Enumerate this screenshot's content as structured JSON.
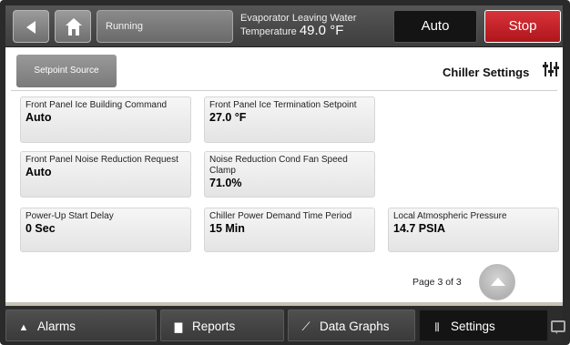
{
  "header": {
    "status_label": "Running",
    "evap_label_line1": "Evaporator Leaving Water",
    "evap_label_line2": "Temperature",
    "evap_value": "49.0 °F",
    "auto_label": "Auto",
    "stop_label": "Stop"
  },
  "panel": {
    "setpoint_source_label": "Setpoint Source",
    "title": "Chiller Settings",
    "tiles": [
      {
        "label": "Front Panel Ice Building Command",
        "value": "Auto"
      },
      {
        "label": "Front Panel Ice Termination Setpoint",
        "value": "27.0 °F"
      },
      {
        "label": "Front Panel Noise Reduction Request",
        "value": "Auto"
      },
      {
        "label": "Noise Reduction Cond Fan Speed Clamp",
        "value": "71.0%"
      },
      {
        "label": "Power-Up Start Delay",
        "value": "0 Sec"
      },
      {
        "label": "Chiller Power Demand Time Period",
        "value": "15 Min"
      },
      {
        "label": "Local Atmospheric Pressure",
        "value": "14.7 PSIA"
      }
    ],
    "page_indicator": "Page 3 of 3"
  },
  "bottom_nav": {
    "alarms": "Alarms",
    "reports": "Reports",
    "data_graphs": "Data Graphs",
    "settings": "Settings"
  },
  "icons": [
    "back-arrow-icon",
    "home-icon",
    "sliders-icon",
    "up-arrow-icon",
    "bell-icon",
    "report-icon",
    "graph-icon",
    "settings-icon",
    "chat-icon"
  ],
  "colors": {
    "stop": "#c8252c",
    "active_tab": "#141414",
    "panel_bg": "#ffffff"
  }
}
